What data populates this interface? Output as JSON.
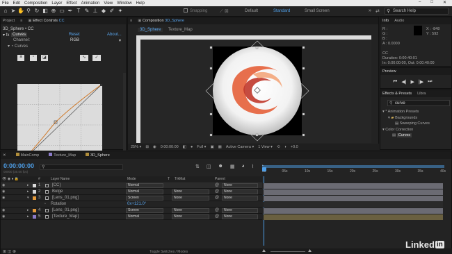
{
  "menu": [
    "File",
    "Edit",
    "Composition",
    "Layer",
    "Effect",
    "Animation",
    "View",
    "Window",
    "Help"
  ],
  "toolbar": {
    "snapping": "Snapping",
    "workspaces": [
      "Default",
      "Standard",
      "Small Screen"
    ],
    "search_placeholder": "Search Help"
  },
  "project_panel": {
    "tab": "Project",
    "tab_close": "≡"
  },
  "effect_controls": {
    "tab_label": "Effect Controls",
    "tab_target": "CC",
    "breadcrumb": "3D_Sphere • CC",
    "effect_name": "Curves",
    "reset": "Reset",
    "about": "About...",
    "channel_label": "Channel:",
    "channel_value": "RGB",
    "curves_prop": "Curves"
  },
  "composition": {
    "tab_prefix": "Composition",
    "tab_name": "3D_Sphere",
    "sub_tabs": [
      "3D_Sphere",
      "Texture_Map"
    ],
    "zoom": "25%",
    "timecode": "0:00:00:00",
    "resolution": "Full",
    "camera": "Active Camera",
    "views": "1 View",
    "offset": "+0.0"
  },
  "info": {
    "tabs": [
      "Info",
      "Audio"
    ],
    "r": "R :",
    "g": "G :",
    "b": "B :",
    "a": "A : 0.0000",
    "x": "X : -848",
    "y": "Y : 592",
    "layer": "CC",
    "duration": "Duration: 0:00:40:01",
    "in_out": "In: 0:00:00:00, Out: 0:00:40:00"
  },
  "preview": {
    "tab": "Preview"
  },
  "effects_presets": {
    "tabs": [
      "Effects & Presets",
      "Libra"
    ],
    "search_value": "curve",
    "tree": [
      "* Animation Presets",
      "Backgrounds",
      "Sweeping Curves",
      "Color Correction",
      "Curves"
    ]
  },
  "timeline": {
    "tabs": [
      "MainComp",
      "Texture_Map",
      "3D_Sphere"
    ],
    "timecode": "0:00:00:00",
    "fps": "00000 (30.00 fps)",
    "columns": {
      "name": "Layer Name",
      "mode": "Mode",
      "t": "T",
      "trkmat": "TrkMat",
      "parent": "Parent"
    },
    "layers": [
      {
        "num": "1",
        "name": "[CC]",
        "mode": "Normal",
        "trkmat": "",
        "parent": "None",
        "color": "#d8d8d8"
      },
      {
        "num": "2",
        "name": "Bulge",
        "mode": "Normal",
        "trkmat": "None",
        "parent": "None",
        "color": "#d8d8d8"
      },
      {
        "num": "3",
        "name": "[Lens_01.png]",
        "mode": "Screen",
        "trkmat": "None",
        "parent": "None",
        "color": "#e49a3a"
      },
      {
        "num": "4",
        "name": "[Lens_01.png]",
        "mode": "Screen",
        "trkmat": "None",
        "parent": "None",
        "color": "#e49a3a"
      },
      {
        "num": "5",
        "name": "[Texture_Map]",
        "mode": "Normal",
        "trkmat": "None",
        "parent": "None",
        "color": "#8a7ac8"
      }
    ],
    "rotation_label": "Rotation",
    "rotation_value": "0x+121.0°",
    "ruler": [
      "0s",
      "05s",
      "10s",
      "15s",
      "20s",
      "25s",
      "30s",
      "35s",
      "40s"
    ],
    "footer": "Toggle Switches / Modes"
  },
  "brand": {
    "name": "Linked",
    "badge": "in"
  }
}
